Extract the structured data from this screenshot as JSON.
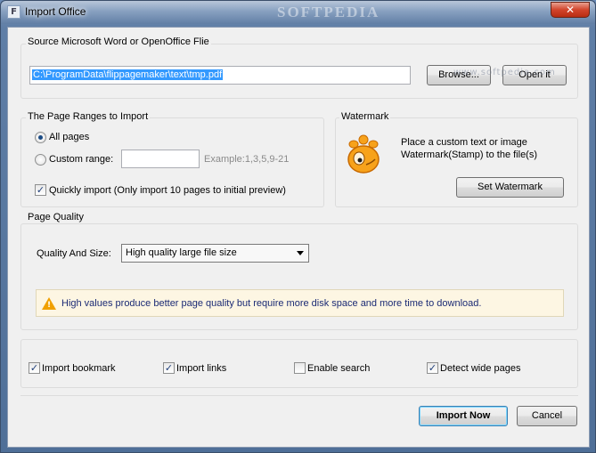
{
  "window": {
    "title": "Import Office",
    "app_icon_glyph": "F",
    "bg_watermark": "SOFTPEDIA",
    "close_glyph": "✕"
  },
  "source": {
    "group_label": "Source Microsoft Word or OpenOffice Flie",
    "path_value": "C:\\ProgramData\\flippagemaker\\text\\tmp.pdf",
    "browse_label": "Browse...",
    "open_label": "Open it",
    "softpedia_note": "www.softpedia.com"
  },
  "ranges": {
    "group_label": "The Page Ranges to Import",
    "all_pages_label": "All pages",
    "all_pages_selected": true,
    "custom_range_label": "Custom range:",
    "custom_range_value": "",
    "example_text": "Example:1,3,5,9-21",
    "quick_import_label": "Quickly import (Only import 10 pages to  initial  preview)",
    "quick_import_checked": true
  },
  "watermark": {
    "group_label": "Watermark",
    "icon": "gimp-logo-icon",
    "description_line1": "Place a custom text or image",
    "description_line2": "Watermark(Stamp) to the file(s)",
    "set_button_label": "Set Watermark"
  },
  "quality": {
    "group_label": "Page Quality",
    "size_label": "Quality And Size:",
    "selected_option": "High quality large file size",
    "info_text": "High values produce better page quality but require more disk space and more time to download.",
    "info_icon": "warning-icon"
  },
  "options": {
    "import_bookmark": {
      "label": "Import bookmark",
      "checked": true
    },
    "import_links": {
      "label": "Import links",
      "checked": true
    },
    "enable_search": {
      "label": "Enable search",
      "checked": false
    },
    "detect_wide_pages": {
      "label": "Detect wide pages",
      "checked": true
    },
    "check_glyph": "✓"
  },
  "footer": {
    "import_label": "Import Now",
    "cancel_label": "Cancel"
  },
  "colors": {
    "selection": "#3399ff",
    "info_text": "#1b2a74",
    "info_bg": "#fdf6e3",
    "warning": "#f0a000"
  }
}
